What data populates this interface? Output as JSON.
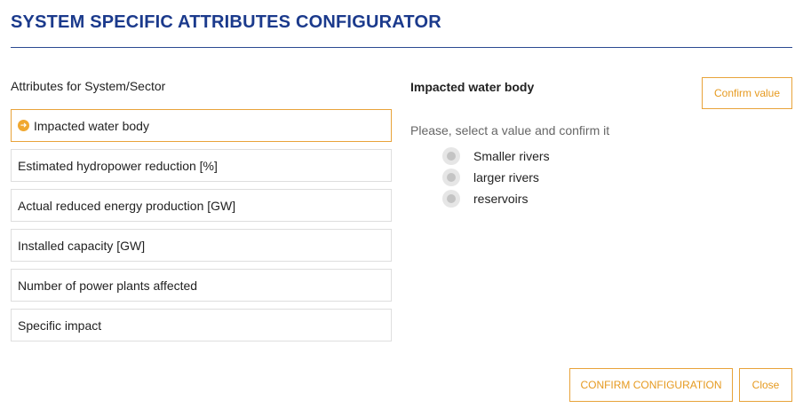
{
  "header": {
    "title": "SYSTEM SPECIFIC ATTRIBUTES CONFIGURATOR"
  },
  "attributes": {
    "heading": "Attributes for System/Sector",
    "items": [
      {
        "label": "Impacted water body",
        "active": true
      },
      {
        "label": "Estimated hydropower reduction [%]",
        "active": false
      },
      {
        "label": "Actual reduced energy production [GW]",
        "active": false
      },
      {
        "label": "Installed capacity [GW]",
        "active": false
      },
      {
        "label": "Number of power plants affected",
        "active": false
      },
      {
        "label": "Specific impact",
        "active": false
      }
    ]
  },
  "detail": {
    "heading": "Impacted water body",
    "confirm_label": "Confirm value",
    "prompt": "Please, select a value and confirm it",
    "options": [
      {
        "label": "Smaller rivers",
        "selected": false
      },
      {
        "label": "larger rivers",
        "selected": false
      },
      {
        "label": "reservoirs",
        "selected": false
      }
    ]
  },
  "footer": {
    "confirm_configuration_label": "CONFIRM CONFIGURATION",
    "close_label": "Close"
  },
  "colors": {
    "title": "#1b3a8c",
    "accent": "#e8a33a"
  },
  "icons": {
    "active_item": "arrow-right-circle-icon"
  }
}
